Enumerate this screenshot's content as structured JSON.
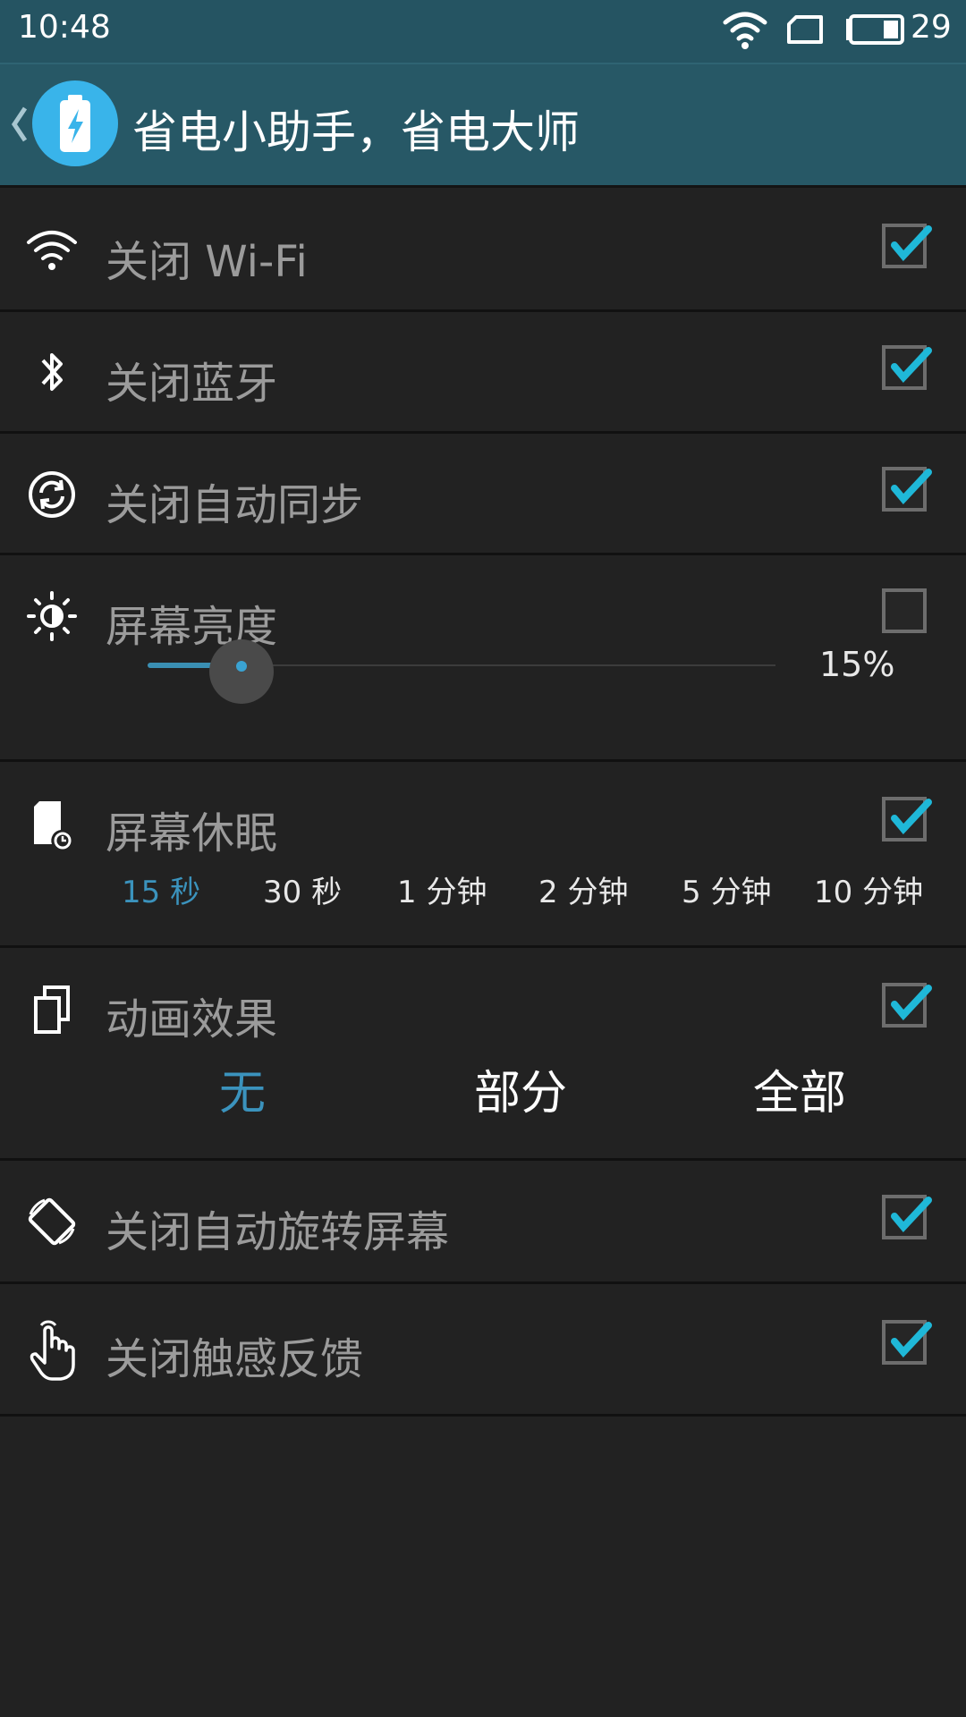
{
  "status_bar": {
    "time": "10:48",
    "battery_level": "29"
  },
  "header": {
    "title": "省电小助手，省电大师"
  },
  "rows": {
    "wifi": {
      "label": "关闭 Wi-Fi",
      "checked": true
    },
    "bluetooth": {
      "label": "关闭蓝牙",
      "checked": true
    },
    "sync": {
      "label": "关闭自动同步",
      "checked": true
    },
    "brightness": {
      "label": "屏幕亮度",
      "checked": false,
      "value": 15,
      "value_text": "15%"
    },
    "sleep": {
      "label": "屏幕休眠",
      "checked": true,
      "options": [
        "15 秒",
        "30 秒",
        "1 分钟",
        "2 分钟",
        "5 分钟",
        "10 分钟"
      ],
      "selected": "15 秒"
    },
    "animation": {
      "label": "动画效果",
      "checked": true,
      "options": [
        "无",
        "部分",
        "全部"
      ],
      "selected": "无"
    },
    "rotate": {
      "label": "关闭自动旋转屏幕",
      "checked": true
    },
    "haptic": {
      "label": "关闭触感反馈",
      "checked": true
    }
  },
  "colors": {
    "accent": "#3b93bd",
    "check": "#1fb8d8",
    "header_bg": "#275866"
  }
}
